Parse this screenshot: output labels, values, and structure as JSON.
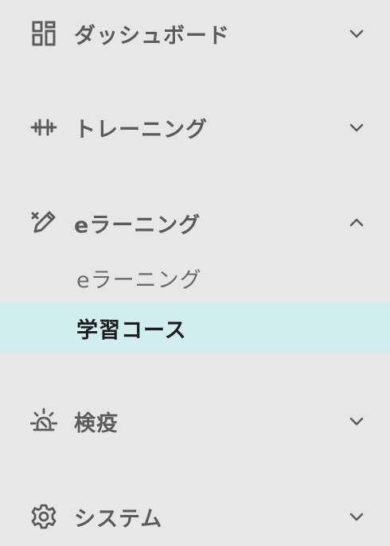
{
  "menu": {
    "dashboard": {
      "label": "ダッシュボード",
      "icon": "dashboard-icon",
      "expanded": false
    },
    "training": {
      "label": "トレーニング",
      "icon": "dumbbell-icon",
      "expanded": false
    },
    "elearning": {
      "label": "eラーニング",
      "icon": "pencil-icon",
      "expanded": true,
      "children": [
        {
          "label": "eラーニング",
          "active": false
        },
        {
          "label": "学習コース",
          "active": true
        }
      ]
    },
    "quarantine": {
      "label": "検疫",
      "icon": "alarm-light-icon",
      "expanded": false
    },
    "system": {
      "label": "システム",
      "icon": "gear-icon",
      "expanded": false
    }
  },
  "colors": {
    "background": "#e6e7e6",
    "active_background": "#d2eded",
    "text": "#5b5b5b",
    "active_text": "#1c1c1c"
  }
}
